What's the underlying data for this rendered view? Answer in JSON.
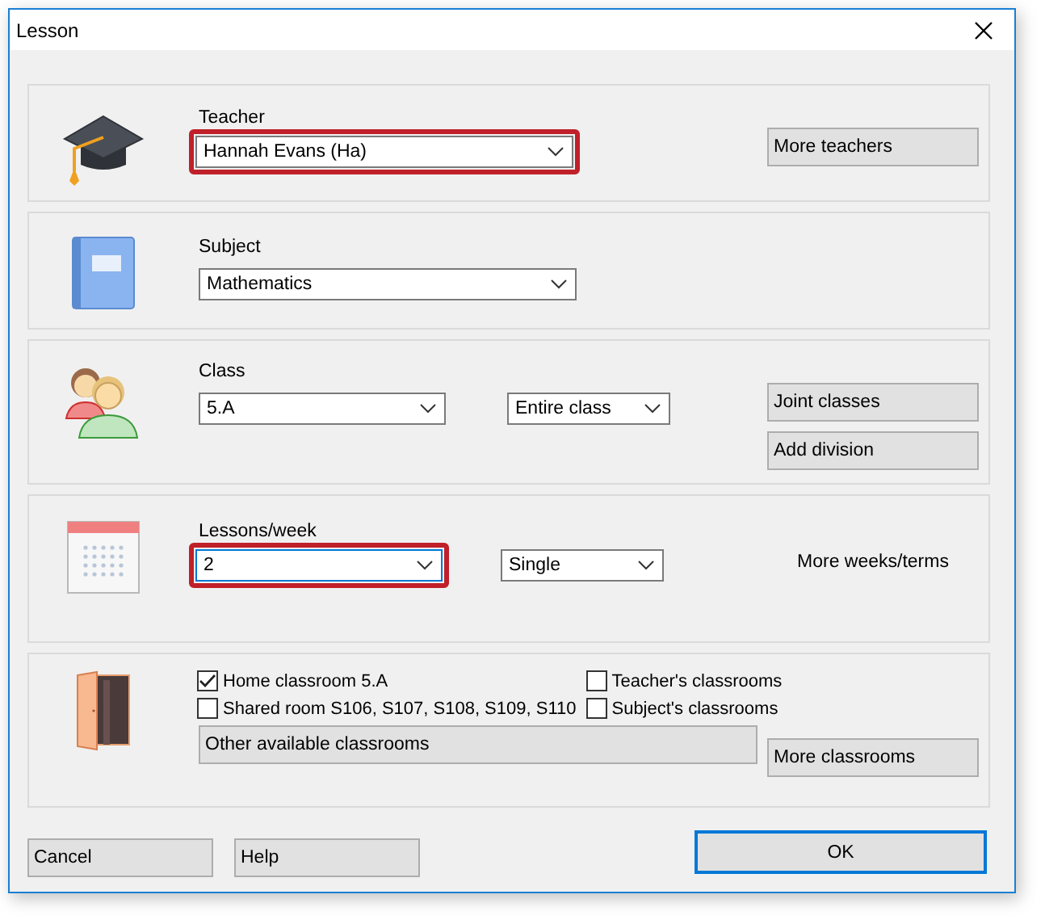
{
  "window": {
    "title": "Lesson"
  },
  "sections": [
    {
      "kind": "teacher",
      "label": "Teacher",
      "combo": {
        "value": "Hannah Evans (Ha)",
        "highlighted": true
      },
      "buttons": [
        "More teachers"
      ]
    },
    {
      "kind": "subject",
      "label": "Subject",
      "combo": {
        "value": "Mathematics",
        "highlighted": false
      }
    },
    {
      "kind": "class",
      "label": "Class",
      "combo": {
        "value": "5.A",
        "highlighted": false
      },
      "combo2": {
        "value": "Entire class"
      },
      "buttons": [
        "Joint classes",
        "Add division"
      ]
    },
    {
      "kind": "lessons",
      "label": "Lessons/week",
      "combo": {
        "value": "2",
        "highlighted": true
      },
      "combo2": {
        "value": "Single"
      },
      "note": "More weeks/terms"
    },
    {
      "kind": "classrooms",
      "checkboxes": [
        {
          "label": "Home classroom 5.A",
          "checked": true
        },
        {
          "label": "Teacher's classrooms",
          "checked": false
        },
        {
          "label": "Shared room S106, S107, S108, S109, S110",
          "checked": false
        },
        {
          "label": "Subject's classrooms",
          "checked": false
        }
      ],
      "wide_button": "Other available classrooms",
      "buttons": [
        "More classrooms"
      ]
    }
  ],
  "buttons": [
    {
      "label": "Cancel",
      "default": false
    },
    {
      "label": "Help",
      "default": false
    },
    {
      "label": "OK",
      "default": true
    }
  ]
}
